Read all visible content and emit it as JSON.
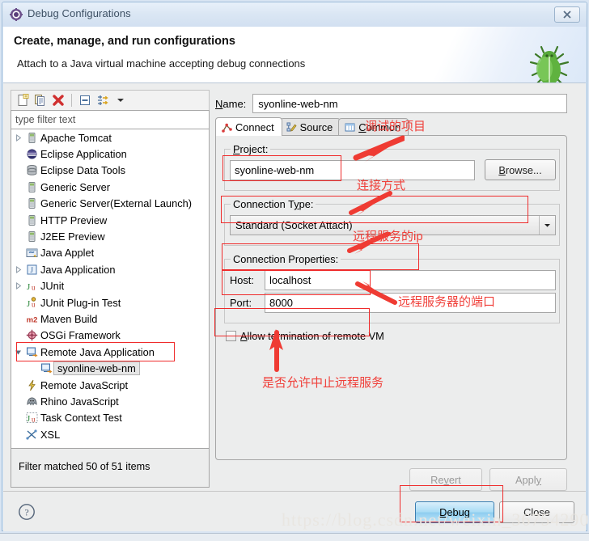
{
  "window": {
    "title": "Debug Configurations",
    "title_icon": "debug-gear-icon",
    "close_label": "×"
  },
  "header": {
    "title": "Create, manage, and run configurations",
    "subtitle": "Attach to a Java virtual machine accepting debug connections",
    "icon": "green-bug-icon"
  },
  "left": {
    "toolbar": [
      {
        "name": "new-configuration-icon",
        "tooltip": "New launch configuration"
      },
      {
        "name": "duplicate-configuration-icon",
        "tooltip": "Duplicate"
      },
      {
        "name": "delete-configuration-icon",
        "tooltip": "Delete"
      },
      {
        "name": "collapse-all-icon",
        "tooltip": "Collapse All"
      },
      {
        "name": "filter-launch-configurations-icon",
        "tooltip": "Filter"
      },
      {
        "name": "view-menu-chevron-icon",
        "tooltip": "View Menu"
      }
    ],
    "filter_placeholder": "type filter text",
    "filter_value": "",
    "tree": [
      {
        "label": "Apache Tomcat",
        "icon": "server-icon",
        "expandable": true,
        "expanded": false,
        "indent": 0,
        "selected": false
      },
      {
        "label": "Eclipse Application",
        "icon": "eclipse-icon",
        "expandable": false,
        "indent": 0,
        "selected": false
      },
      {
        "label": "Eclipse Data Tools",
        "icon": "database-icon",
        "expandable": false,
        "indent": 0,
        "selected": false
      },
      {
        "label": "Generic Server",
        "icon": "server-icon",
        "expandable": false,
        "indent": 0,
        "selected": false
      },
      {
        "label": "Generic Server(External Launch)",
        "icon": "server-icon",
        "expandable": false,
        "indent": 0,
        "selected": false
      },
      {
        "label": "HTTP Preview",
        "icon": "server-icon",
        "expandable": false,
        "indent": 0,
        "selected": false
      },
      {
        "label": "J2EE Preview",
        "icon": "server-icon",
        "expandable": false,
        "indent": 0,
        "selected": false
      },
      {
        "label": "Java Applet",
        "icon": "java-applet-icon",
        "expandable": false,
        "indent": 0,
        "selected": false
      },
      {
        "label": "Java Application",
        "icon": "java-application-icon",
        "expandable": true,
        "expanded": false,
        "indent": 0,
        "selected": false
      },
      {
        "label": "JUnit",
        "icon": "junit-icon",
        "expandable": true,
        "expanded": false,
        "indent": 0,
        "selected": false
      },
      {
        "label": "JUnit Plug-in Test",
        "icon": "junit-plugin-icon",
        "expandable": false,
        "indent": 0,
        "selected": false
      },
      {
        "label": "Maven Build",
        "icon": "maven-icon",
        "expandable": false,
        "indent": 0,
        "selected": false
      },
      {
        "label": "OSGi Framework",
        "icon": "osgi-icon",
        "expandable": false,
        "indent": 0,
        "selected": false
      },
      {
        "label": "Remote Java Application",
        "icon": "remote-java-application-icon",
        "expandable": true,
        "expanded": true,
        "indent": 0,
        "selected": false
      },
      {
        "label": "syonline-web-nm",
        "icon": "remote-java-application-icon",
        "expandable": false,
        "indent": 1,
        "selected": true
      },
      {
        "label": "Remote JavaScript",
        "icon": "remote-javascript-icon",
        "expandable": false,
        "indent": 0,
        "selected": false
      },
      {
        "label": "Rhino JavaScript",
        "icon": "rhino-icon",
        "expandable": false,
        "indent": 0,
        "selected": false
      },
      {
        "label": "Task Context Test",
        "icon": "task-context-icon",
        "expandable": false,
        "indent": 0,
        "selected": false
      },
      {
        "label": "XSL",
        "icon": "xsl-icon",
        "expandable": false,
        "indent": 0,
        "selected": false
      }
    ],
    "filter_status": "Filter matched 50 of 51 items"
  },
  "right": {
    "name_label": "Name:",
    "name_value": "syonline-web-nm",
    "tabs": [
      {
        "label": "Connect",
        "icon": "connect-icon",
        "active": true
      },
      {
        "label": "Source",
        "icon": "source-icon",
        "active": false
      },
      {
        "label": "Common",
        "icon": "common-icon",
        "active": false
      }
    ],
    "project_group_label": "Project:",
    "project_value": "syonline-web-nm",
    "browse_label": "Browse...",
    "connection_type_label": "Connection Type:",
    "connection_type_value": "Standard (Socket Attach)",
    "connection_properties_label": "Connection Properties:",
    "host_label": "Host:",
    "host_value": "localhost",
    "port_label": "Port:",
    "port_value": "8000",
    "allow_termination_label": "Allow termination of remote VM",
    "allow_termination_checked": false,
    "revert_label": "Revert",
    "apply_label": "Apply"
  },
  "footer": {
    "help_icon": "help-question-icon",
    "debug_label": "Debug",
    "close_label": "Close"
  },
  "annotations": [
    {
      "id": "ann-project",
      "text": "调试的项目"
    },
    {
      "id": "ann-connection-type",
      "text": "连接方式"
    },
    {
      "id": "ann-host",
      "text": "远程服务的ip"
    },
    {
      "id": "ann-port",
      "text": "远程服务器的端口"
    },
    {
      "id": "ann-terminate",
      "text": "是否允许中止远程服务"
    }
  ],
  "watermark": "https://blog.csdn.net/weixin_36754290"
}
